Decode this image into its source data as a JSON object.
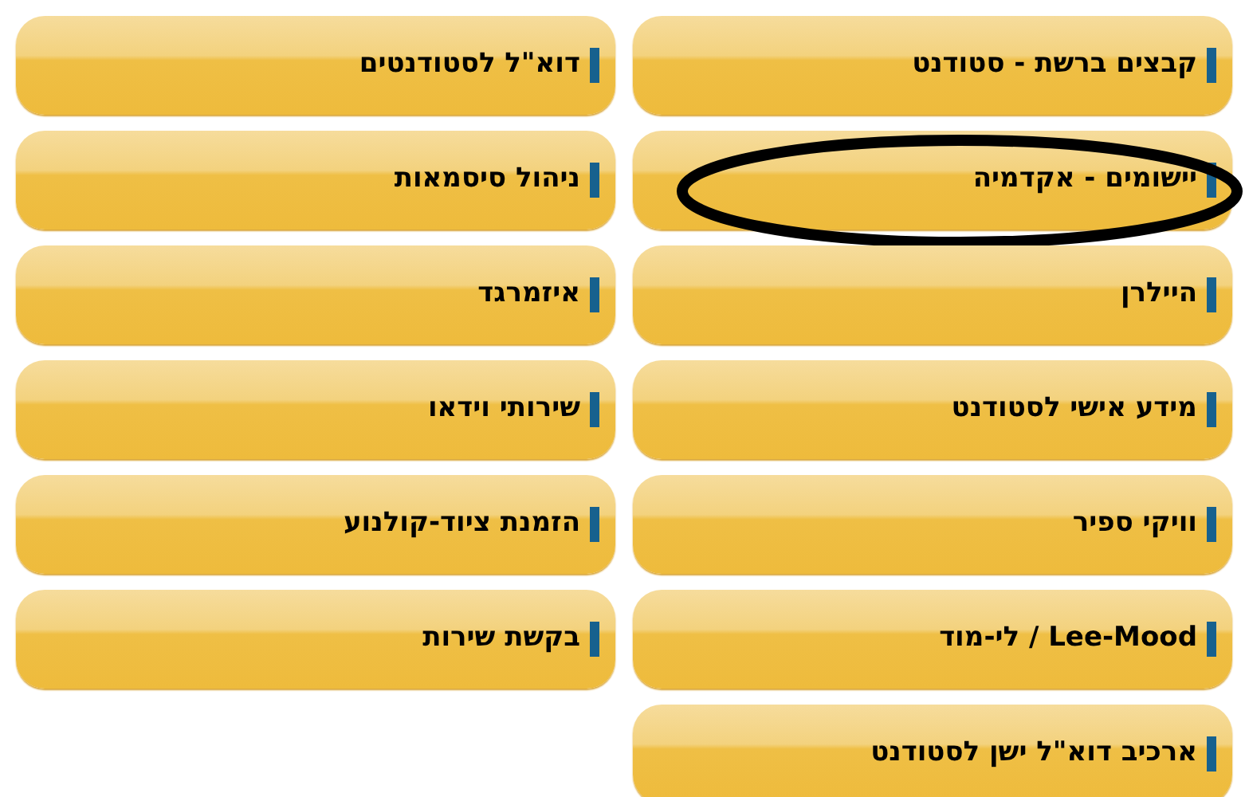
{
  "columns": [
    {
      "items": [
        {
          "label": "קבצים ברשת - סטודנט",
          "circled": false
        },
        {
          "label": "יישומים - אקדמיה",
          "circled": true
        },
        {
          "label": "היילרן",
          "circled": false
        },
        {
          "label": "מידע אישי לסטודנט",
          "circled": false
        },
        {
          "label": "וויקי ספיר",
          "circled": false
        },
        {
          "label": "Lee-Mood / לי-מוד",
          "circled": false
        },
        {
          "label": "ארכיב דוא\"ל ישן לסטודנט",
          "circled": false
        }
      ]
    },
    {
      "items": [
        {
          "label": "דוא\"ל לסטודנטים",
          "circled": false
        },
        {
          "label": "ניהול סיסמאות",
          "circled": false
        },
        {
          "label": "איזמרגד",
          "circled": false
        },
        {
          "label": "שירותי וידאו",
          "circled": false
        },
        {
          "label": "הזמנת ציוד-קולנוע",
          "circled": false
        },
        {
          "label": "בקשת שירות",
          "circled": false
        }
      ]
    }
  ]
}
